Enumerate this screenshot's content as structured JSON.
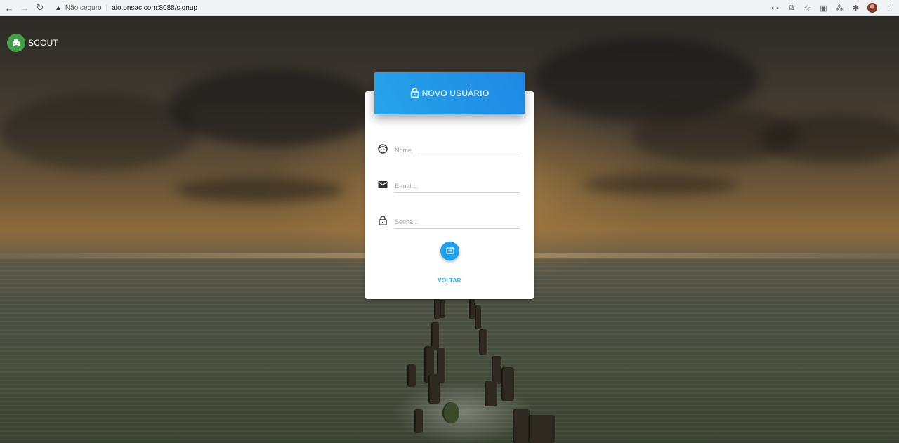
{
  "browser": {
    "security_label": "Não seguro",
    "url": "aio.onsac.com:8088/signup",
    "icons": [
      "back-icon",
      "forward-icon",
      "reload-icon",
      "warning-icon",
      "key-icon",
      "translate-icon",
      "star-icon",
      "extension-icon",
      "qr-icon",
      "puzzle-icon",
      "profile-avatar",
      "menu-icon"
    ]
  },
  "app": {
    "logo_text": "SCOUT",
    "logo_icon": "robot-icon",
    "brand_color": "#43a047"
  },
  "signup_card": {
    "title": "NOVO USUÁRIO",
    "title_icon": "lock-icon",
    "header_color": "#1e88e5",
    "fields": {
      "name": {
        "placeholder": "Nome...",
        "value": "",
        "icon": "face-icon"
      },
      "email": {
        "placeholder": "E-mail...",
        "value": "",
        "icon": "mail-icon"
      },
      "password": {
        "placeholder": "Senha...",
        "value": "",
        "icon": "lock-icon"
      }
    },
    "submit_icon": "enter-icon",
    "back_label": "VOLTAR",
    "accent_color": "#29a8e8"
  }
}
